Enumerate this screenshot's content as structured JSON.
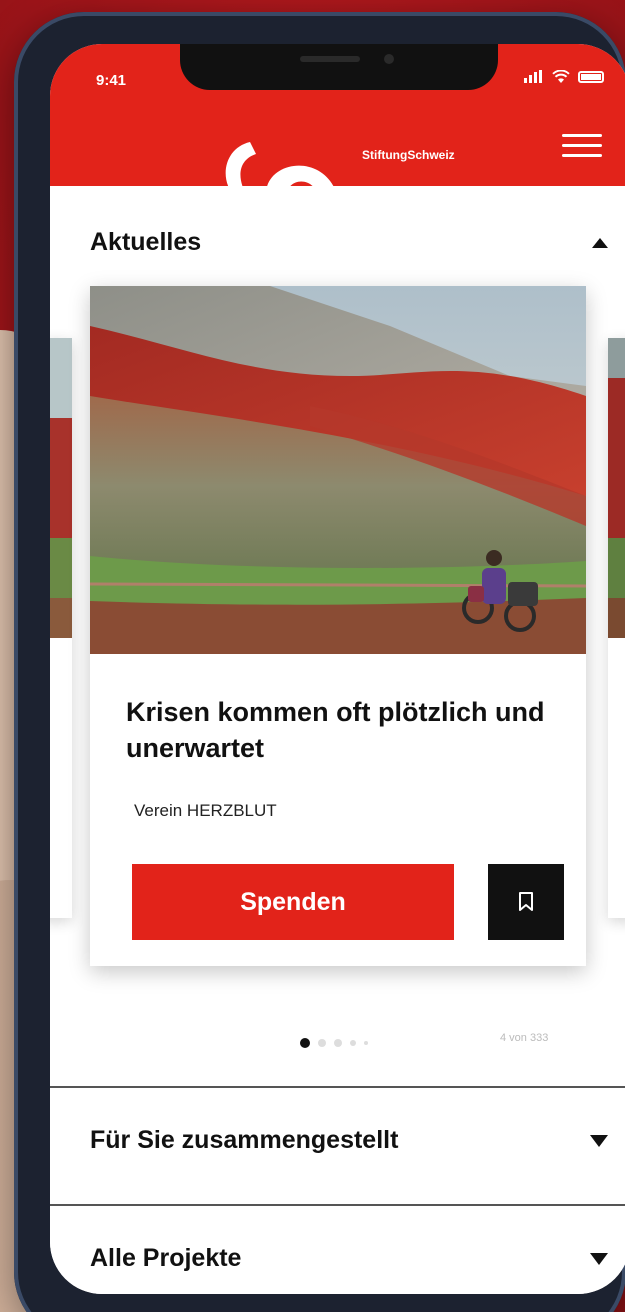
{
  "status_bar": {
    "time": "9:41"
  },
  "header": {
    "brand": "StiftungSchweiz"
  },
  "sections": {
    "news": {
      "title": "Aktuelles"
    },
    "curated": {
      "title": "Für Sie zusammengestellt"
    },
    "all_projects": {
      "title": "Alle Projekte"
    }
  },
  "featured_card": {
    "title": "Krisen kommen oft plötzlich und unerwartet",
    "organization": "Verein HERZBLUT",
    "donate_label": "Spenden"
  },
  "pager": {
    "counter": "4 von 333"
  },
  "icons": [
    "signal-icon",
    "wifi-icon",
    "battery-icon",
    "menu-icon",
    "collapse-arrow-icon",
    "expand-arrow-icon",
    "bookmark-icon"
  ],
  "colors": {
    "brand_red": "#e2231a",
    "text": "#111111",
    "button_dark": "#111111"
  }
}
